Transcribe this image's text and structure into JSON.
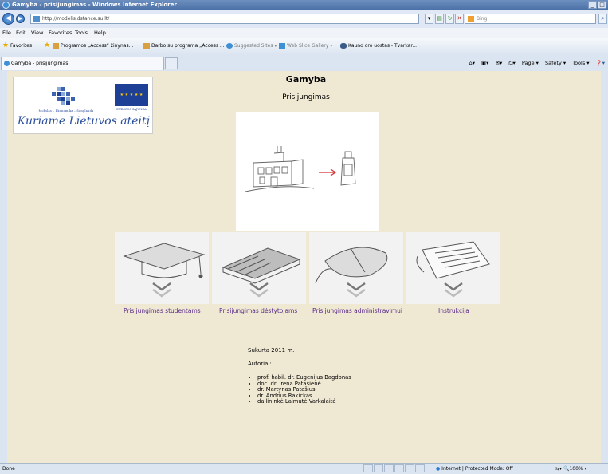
{
  "window": {
    "title": "Gamyba - prisijungimas - Windows Internet Explorer"
  },
  "address_bar": {
    "url": "http://modelis.dstance.su.lt/"
  },
  "search_box": {
    "placeholder": "Bing"
  },
  "menu": {
    "items": [
      "File",
      "Edit",
      "View",
      "Favorites",
      "Tools",
      "Help"
    ]
  },
  "favorites_bar": {
    "label": "Favorites",
    "items": [
      "Programos „Access“ žinynas...",
      "Darbo su programa „Access ...",
      "Suggested Sites ▾",
      "Web Slice Gallery ▾",
      "Kauno oro uostas - Tvarkar..."
    ]
  },
  "tab": {
    "label": "Gamyba - prisijungimas"
  },
  "command_bar": {
    "items": [
      "Page ▾",
      "Safety ▾",
      "Tools ▾"
    ]
  },
  "logo": {
    "small_text": "Mokslas – Ekonomika – Sanglauda",
    "big_text": "Kuriame Lietuvos ateitį",
    "eu_text": "EUROPOS SĄJUNGA"
  },
  "page": {
    "title": "Gamyba",
    "subtitle": "Prisijungimas"
  },
  "links": [
    "Prisijungimas studentams",
    "Prisijungimas dėstytojams",
    "Prisijungimas administravimui",
    "Instrukcija"
  ],
  "info": {
    "created": "Sukurta 2011 m.",
    "authors_label": "Autoriai:",
    "authors": [
      "prof. habil. dr. Eugenijus Bagdonas",
      "doc. dr. Irena Patašienė",
      "dr. Martynas Patašius",
      "dr. Andrius Rakickas",
      "dailininkė Laimutė Varkalaitė"
    ]
  },
  "status_bar": {
    "status": "Done",
    "zone": "Internet | Protected Mode: Off",
    "zoom": "100%"
  }
}
